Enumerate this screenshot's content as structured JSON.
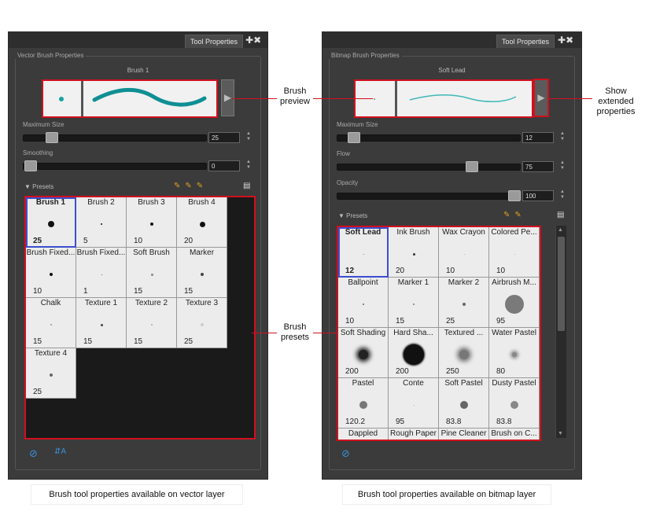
{
  "vector": {
    "tab_label": "Tool Properties",
    "group_title": "Vector Brush Properties",
    "brush_name": "Brush 1",
    "max_size_label": "Maximum Size",
    "max_size_value": "25",
    "smoothing_label": "Smoothing",
    "smoothing_value": "0",
    "presets_label": "Presets",
    "presets": [
      {
        "name": "Brush 1",
        "size": "25"
      },
      {
        "name": "Brush 2",
        "size": "5"
      },
      {
        "name": "Brush 3",
        "size": "10"
      },
      {
        "name": "Brush 4",
        "size": "20"
      },
      {
        "name": "Brush Fixed...",
        "size": "10"
      },
      {
        "name": "Brush Fixed...",
        "size": "1"
      },
      {
        "name": "Soft Brush",
        "size": "15"
      },
      {
        "name": "Marker",
        "size": "15"
      },
      {
        "name": "Chalk",
        "size": "15"
      },
      {
        "name": "Texture 1",
        "size": "15"
      },
      {
        "name": "Texture 2",
        "size": "15"
      },
      {
        "name": "Texture 3",
        "size": "25"
      },
      {
        "name": "Texture 4",
        "size": "25"
      }
    ],
    "caption": "Brush tool properties available on vector layer"
  },
  "bitmap": {
    "tab_label": "Tool Properties",
    "group_title": "Bitmap Brush Properties",
    "brush_name": "Soft Lead",
    "max_size_label": "Maximum Size",
    "max_size_value": "12",
    "flow_label": "Flow",
    "flow_value": "75",
    "opacity_label": "Opacity",
    "opacity_value": "100",
    "presets_label": "Presets",
    "presets": [
      {
        "name": "Soft Lead",
        "size": "12"
      },
      {
        "name": "Ink Brush",
        "size": "20"
      },
      {
        "name": "Wax Crayon",
        "size": "10"
      },
      {
        "name": "Colored Pe...",
        "size": "10"
      },
      {
        "name": "Ballpoint",
        "size": "10"
      },
      {
        "name": "Marker 1",
        "size": "15"
      },
      {
        "name": "Marker 2",
        "size": "25"
      },
      {
        "name": "Airbrush M...",
        "size": "95"
      },
      {
        "name": "Soft Shading",
        "size": "200"
      },
      {
        "name": "Hard Sha...",
        "size": "200"
      },
      {
        "name": "Textured ...",
        "size": "250"
      },
      {
        "name": "Water Pastel",
        "size": "80"
      },
      {
        "name": "Pastel",
        "size": "120.2"
      },
      {
        "name": "Conte",
        "size": "95"
      },
      {
        "name": "Soft Pastel",
        "size": "83.8"
      },
      {
        "name": "Dusty Pastel",
        "size": "83.8"
      },
      {
        "name": "Dappled",
        "size": ""
      },
      {
        "name": "Rough Paper",
        "size": ""
      },
      {
        "name": "Pine Cleaner",
        "size": ""
      },
      {
        "name": "Brush on C...",
        "size": ""
      }
    ],
    "caption": "Brush tool properties available on bitmap layer"
  },
  "callouts": {
    "brush_preview": "Brush\npreview",
    "brush_presets": "Brush\npresets",
    "show_extended": "Show\nextended\nproperties"
  },
  "colors": {
    "highlight": "#d0101e",
    "selection": "#3b4fd0",
    "panel": "#3b3b3b"
  }
}
